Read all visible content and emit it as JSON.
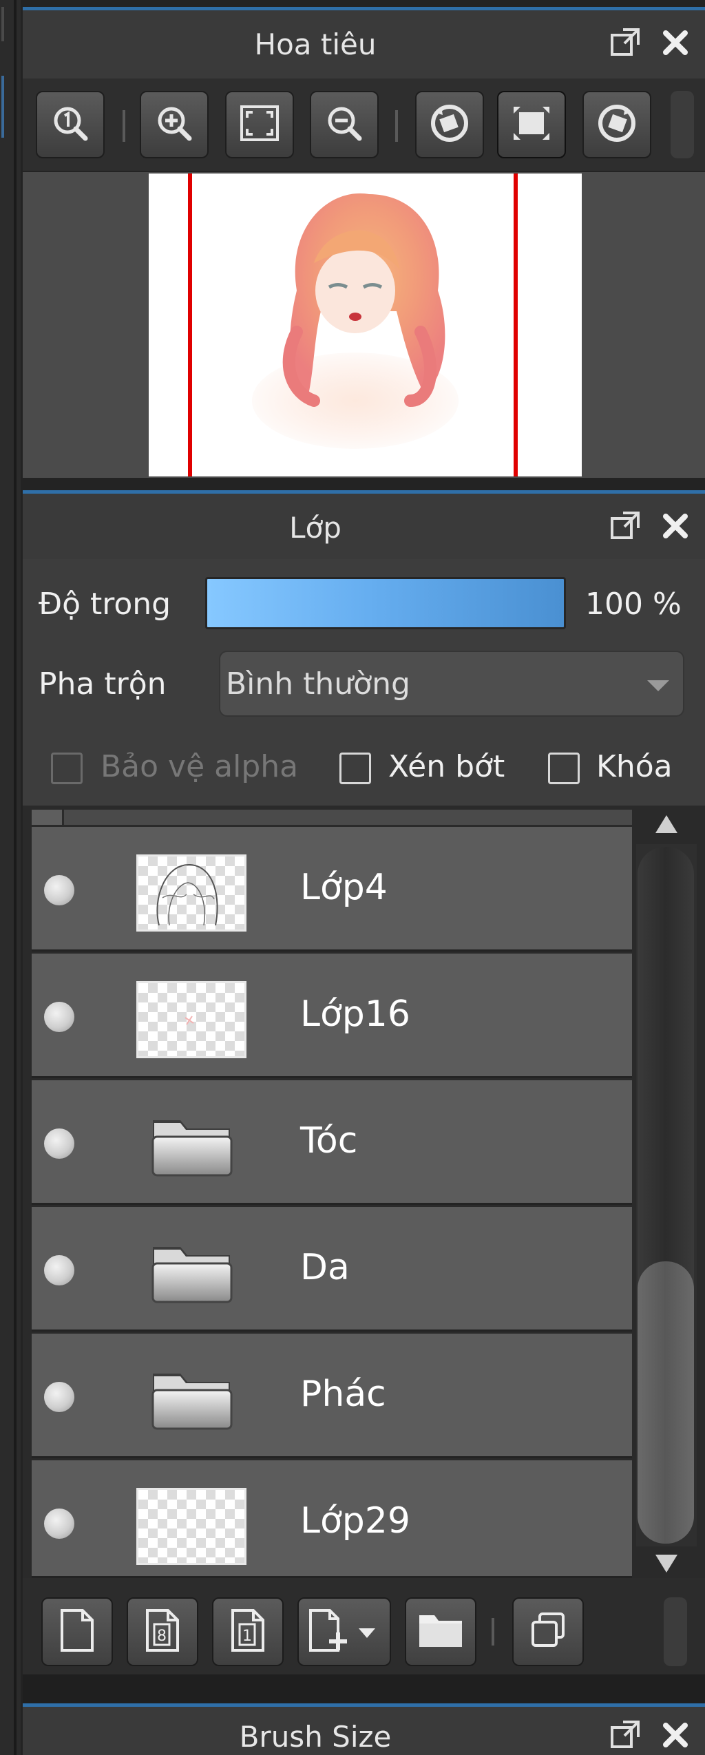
{
  "navigator": {
    "title": "Hoa tiêu",
    "toolbar": [
      {
        "id": "zoom-actual",
        "icon": "zoom-100-icon"
      },
      {
        "id": "zoom-in",
        "icon": "zoom-in-icon"
      },
      {
        "id": "fit",
        "icon": "fit-screen-icon"
      },
      {
        "id": "zoom-out",
        "icon": "zoom-out-icon"
      },
      {
        "id": "rotate-left",
        "icon": "rotate-left-icon"
      },
      {
        "id": "flip",
        "icon": "flip-icon"
      },
      {
        "id": "rotate-right",
        "icon": "rotate-right-icon"
      }
    ]
  },
  "layer_panel": {
    "title": "Lớp",
    "opacity_label": "Độ trong",
    "opacity_value": "100 %",
    "opacity_fraction": 1.0,
    "blend_label": "Pha trộn",
    "blend_value": "Bình thường",
    "protect_alpha": {
      "label": "Bảo vệ alpha",
      "checked": false,
      "enabled": false
    },
    "clipping": {
      "label": "Xén bớt",
      "checked": false
    },
    "lock": {
      "label": "Khóa",
      "checked": false
    },
    "layers": [
      {
        "name": "Lớp4",
        "type": "layer"
      },
      {
        "name": "Lớp16",
        "type": "layer"
      },
      {
        "name": "Tóc",
        "type": "folder"
      },
      {
        "name": "Da",
        "type": "folder"
      },
      {
        "name": "Phác",
        "type": "folder"
      },
      {
        "name": "Lớp29",
        "type": "layer"
      }
    ],
    "toolbar": [
      {
        "id": "new-layer",
        "icon": "new-page-icon"
      },
      {
        "id": "new-8bit-layer",
        "icon": "page-8-icon"
      },
      {
        "id": "new-1bit-layer",
        "icon": "page-1-icon"
      },
      {
        "id": "add-layer-menu",
        "icon": "add-page-dropdown-icon"
      },
      {
        "id": "new-folder",
        "icon": "folder-icon"
      },
      {
        "id": "duplicate",
        "icon": "duplicate-icon"
      }
    ]
  },
  "brush_size": {
    "title": "Brush Size"
  },
  "colors": {
    "accent": "#2f6fa8",
    "panel_bg": "#3d3d3d",
    "row_bg": "#5c5c5c",
    "guide_red": "#e00000"
  }
}
